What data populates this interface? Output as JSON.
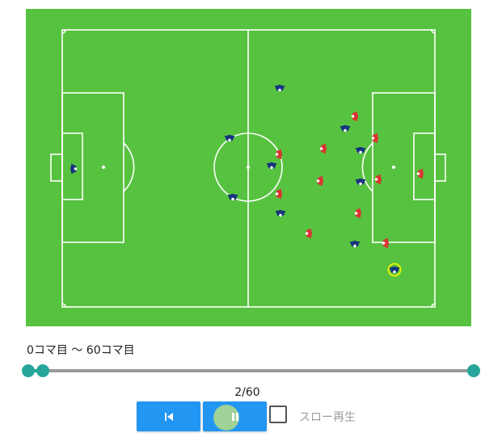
{
  "colors": {
    "pitch": "#57c23f",
    "lines": "#ffffff",
    "team_home": "#d93530",
    "team_away": "#17357c",
    "ball_ring": "#f2f200",
    "accent": "#26a69a",
    "button": "#2196f3"
  },
  "field": {
    "players": [
      {
        "team": "away",
        "role": "goalkeeper",
        "direction": "east"
      },
      {
        "team": "away",
        "role": "outfield",
        "direction": "south"
      },
      {
        "team": "away",
        "role": "outfield",
        "direction": "south"
      },
      {
        "team": "away",
        "role": "outfield",
        "direction": "south"
      },
      {
        "team": "away",
        "role": "outfield",
        "direction": "south"
      },
      {
        "team": "away",
        "role": "outfield",
        "direction": "south"
      },
      {
        "team": "away",
        "role": "outfield",
        "direction": "south"
      },
      {
        "team": "away",
        "role": "outfield",
        "direction": "south"
      },
      {
        "team": "away",
        "role": "outfield",
        "direction": "south"
      },
      {
        "team": "away",
        "role": "outfield",
        "direction": "south"
      },
      {
        "team": "away",
        "role": "outfield",
        "direction": "south",
        "has_ball": true
      },
      {
        "team": "home",
        "role": "goalkeeper",
        "direction": "west"
      },
      {
        "team": "home",
        "role": "outfield",
        "direction": "west"
      },
      {
        "team": "home",
        "role": "outfield",
        "direction": "west"
      },
      {
        "team": "home",
        "role": "outfield",
        "direction": "west"
      },
      {
        "team": "home",
        "role": "outfield",
        "direction": "west"
      },
      {
        "team": "home",
        "role": "outfield",
        "direction": "west"
      },
      {
        "team": "home",
        "role": "outfield",
        "direction": "west"
      },
      {
        "team": "home",
        "role": "outfield",
        "direction": "west"
      },
      {
        "team": "home",
        "role": "outfield",
        "direction": "west"
      },
      {
        "team": "home",
        "role": "outfield",
        "direction": "west"
      },
      {
        "team": "home",
        "role": "outfield",
        "direction": "west"
      }
    ]
  },
  "range": {
    "label": "0コマ目 〜 60コマ目",
    "start": 0,
    "end": 60,
    "current": 2,
    "total": 60
  },
  "playback": {
    "frame_text": "2/60",
    "prev_icon": "skip-previous-icon",
    "pause_icon": "pause-icon",
    "slow_label": "スロー再生",
    "slow_checked": false
  }
}
